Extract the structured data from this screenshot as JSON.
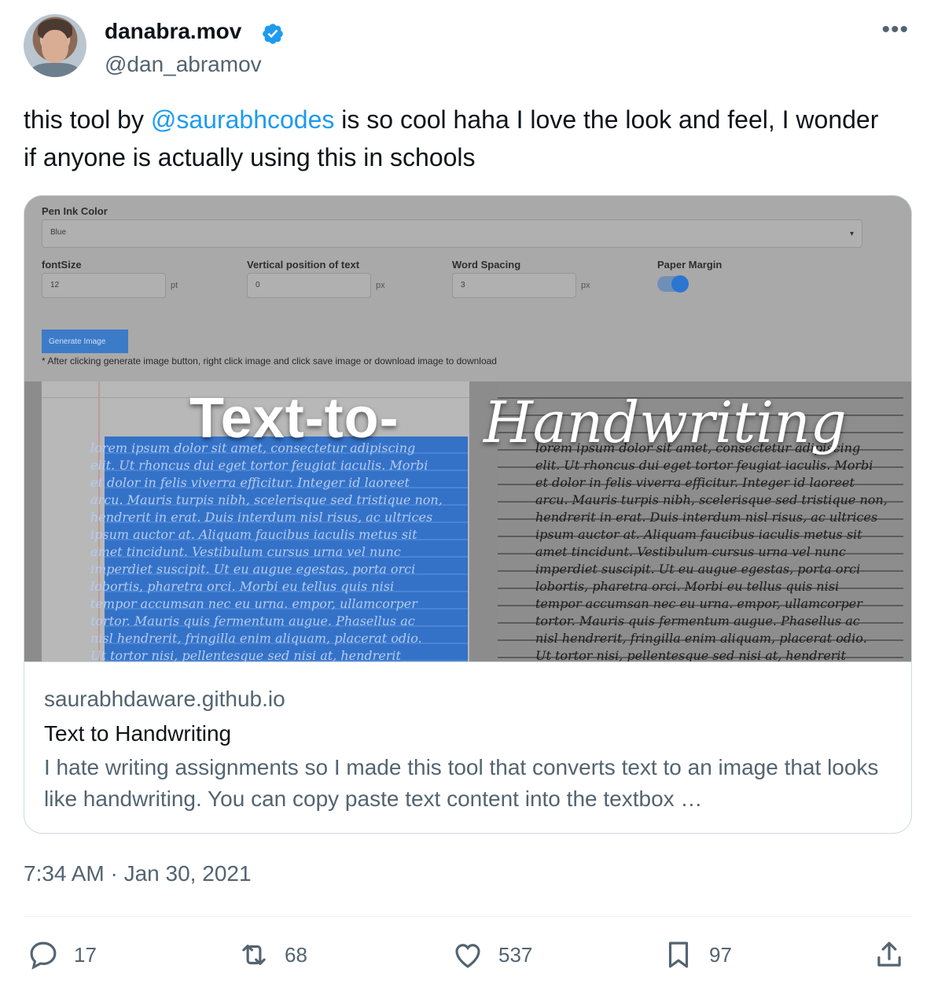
{
  "author": {
    "display_name": "danabra.mov",
    "handle": "@dan_abramov",
    "avatar_icon": "avatar-photo",
    "verified_icon": "verified-badge-icon",
    "verified_color": "#1d9bf0"
  },
  "tweet": {
    "text_before": "this tool by ",
    "mention": "@saurabhcodes",
    "text_after": " is so cool haha I love the look and feel, I wonder if anyone is actually using this in schools",
    "timestamp": "7:34 AM · Jan 30, 2021"
  },
  "card": {
    "image": {
      "banner_bold": "Text-to-",
      "banner_script": "Handwriting",
      "ui": {
        "ink_label": "Pen Ink Color",
        "ink_value": "Blue",
        "font_size_label": "fontSize",
        "font_size_value": "12",
        "font_size_unit": "pt",
        "vertical_label": "Vertical position of text",
        "vertical_value": "0",
        "vertical_unit": "px",
        "word_spacing_label": "Word Spacing",
        "word_spacing_value": "3",
        "word_spacing_unit": "px",
        "paper_margin_label": "Paper Margin",
        "generate_button": "Generate Image",
        "note": "* After clicking generate image button, right click image and click save image or download image to download"
      },
      "script_text": "lorem ipsum dolor sit amet, consectetur adipiscing\nelit. Ut rhoncus dui eget tortor feugiat iaculis. Morbi\net dolor in felis viverra efficitur. Integer id laoreet\narcu. Mauris turpis nibh, scelerisque sed tristique non,\nhendrerit in erat. Duis interdum nisl risus, ac ultrices\nipsum auctor at. Aliquam faucibus iaculis metus sit\namet tincidunt. Vestibulum cursus urna vel nunc\nimperdiet suscipit. Ut eu augue egestas, porta orci\nlobortis, pharetra orci. Morbi eu tellus quis nisi\ntempor accumsan nec eu urna. empor, ullamcorper\ntortor. Mauris quis fermentum augue. Phasellus ac\nnisl hendrerit, fringilla enim aliquam, placerat odio.\nUt tortor nisi, pellentesque sed nisi at, hendrerit"
    },
    "domain": "saurabhdaware.github.io",
    "title": "Text to Handwriting",
    "description": "I hate writing assignments so I made this tool that converts text to an image that looks like handwriting. You can copy paste text content into the textbox …"
  },
  "actions": {
    "replies": "17",
    "reposts": "68",
    "likes": "537",
    "bookmarks": "97"
  },
  "icons": [
    "more-icon",
    "reply-icon",
    "repost-icon",
    "like-icon",
    "bookmark-icon",
    "share-icon"
  ]
}
